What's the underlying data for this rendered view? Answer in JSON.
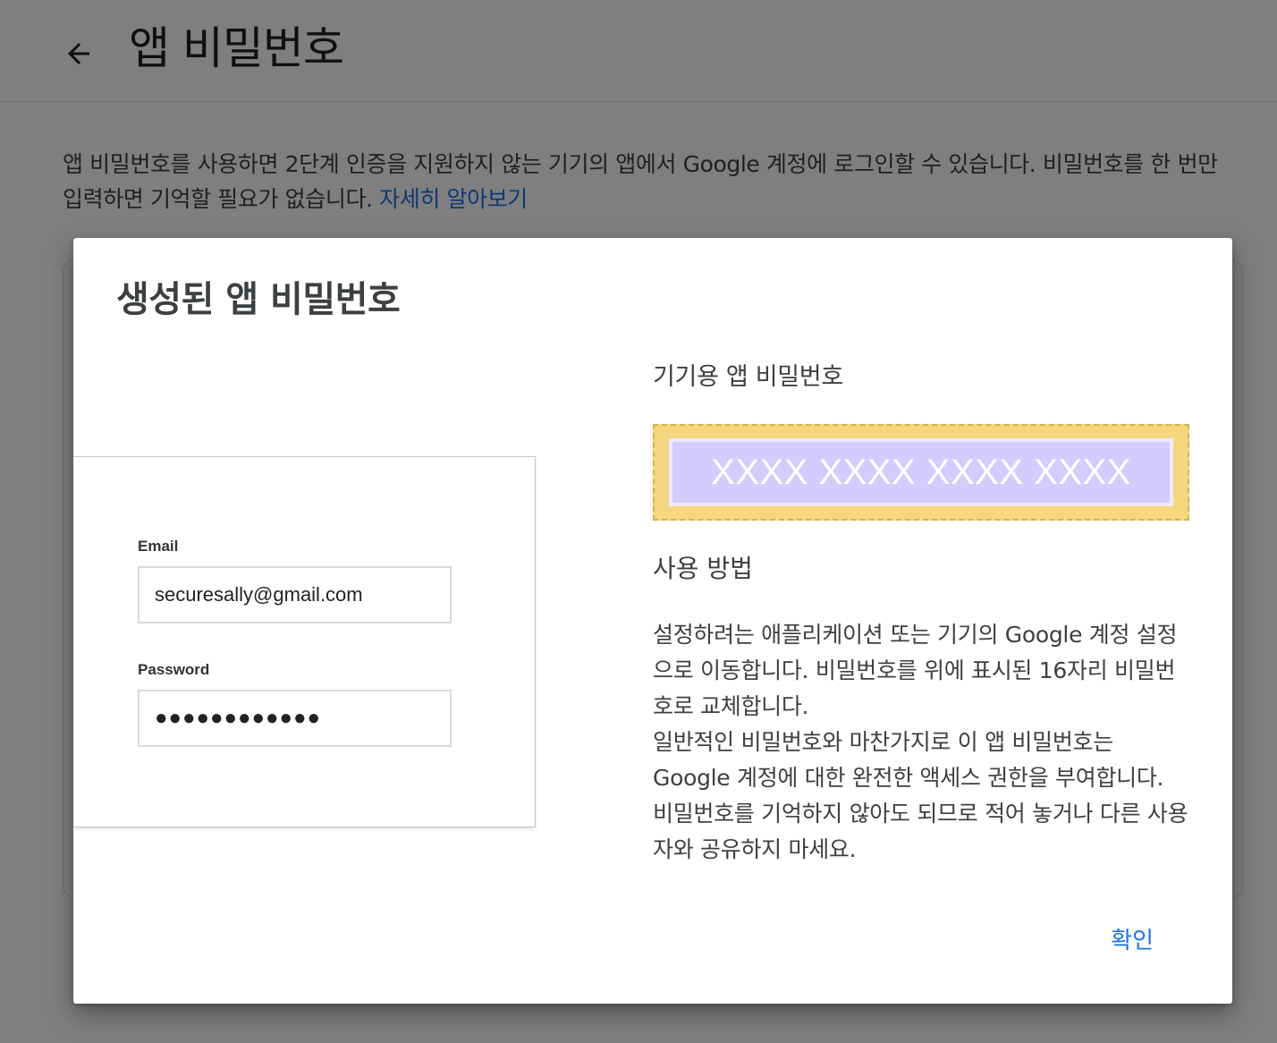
{
  "header": {
    "title": "앱 비밀번호",
    "back_icon": "arrow-left-icon"
  },
  "description": {
    "text": "앱 비밀번호를 사용하면 2단계 인증을 지원하지 않는 기기의 앱에서 Google 계정에 로그인할 수 있습니다. 비밀번호를 한 번만 입력하면 기억할 필요가 없습니다. ",
    "learn_more": "자세히 알아보기"
  },
  "dialog": {
    "title": "생성된 앱 비밀번호",
    "illustration": {
      "email_label": "Email",
      "email_value": "securesally@gmail.com",
      "password_label": "Password",
      "password_value": "●●●●●●●●●●●●"
    },
    "device_password_label": "기기용 앱 비밀번호",
    "generated_password": "XXXX XXXX XXXX XXXX",
    "usage_title": "사용 방법",
    "usage_paragraph_1": "설정하려는 애플리케이션 또는 기기의 Google 계정 설정으로 이동합니다. 비밀번호를 위에 표시된 16자리 비밀번호로 교체합니다.",
    "usage_paragraph_2": "일반적인 비밀번호와 마찬가지로 이 앱 비밀번호는 Google 계정에 대한 완전한 액세스 권한을 부여합니다. 비밀번호를 기억하지 않아도 되므로 적어 놓거나 다른 사용자와 공유하지 마세요.",
    "confirm_button": "확인"
  },
  "colors": {
    "link": "#1a73e8",
    "password_highlight": "#d6cbff",
    "password_frame": "#f6d67e",
    "scrim": "rgba(0,0,0,0.5)"
  }
}
